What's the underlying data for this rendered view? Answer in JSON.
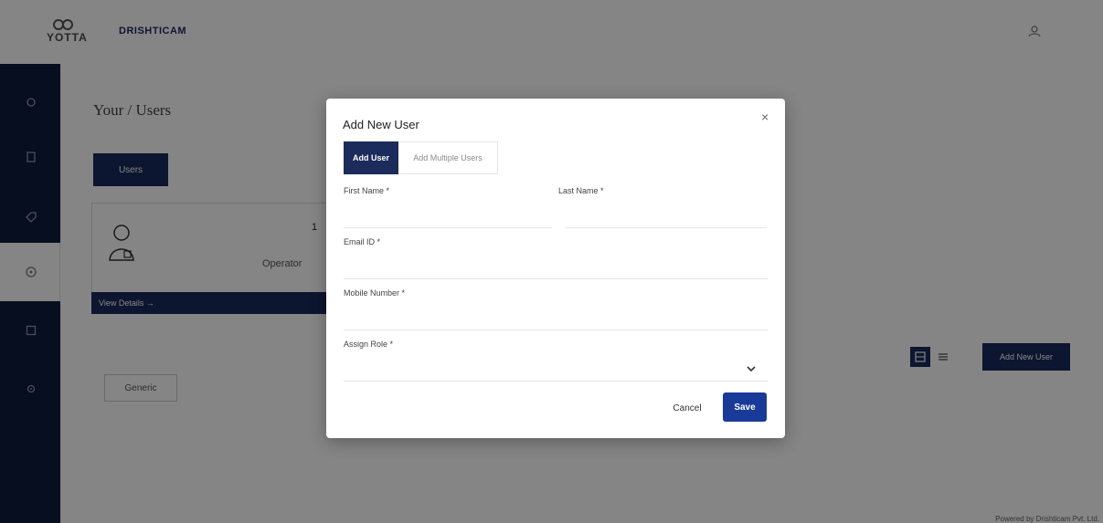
{
  "header": {
    "logo_text": "YOTTA",
    "brand": "DRISHTICAM",
    "profile_icon": "user-circle-icon"
  },
  "sidebar": {
    "items": [
      {
        "icon": "home-icon"
      },
      {
        "icon": "document-icon"
      },
      {
        "icon": "tag-icon"
      },
      {
        "icon": "users-icon",
        "active": true
      },
      {
        "icon": "square-icon"
      },
      {
        "icon": "settings-icon"
      }
    ]
  },
  "page": {
    "title": "Your / Users",
    "users_button": "Users",
    "card": {
      "number": "1",
      "role": "Operator",
      "footer": "View Details →"
    },
    "generic_button": "Generic",
    "add_new_user_button": "Add New User",
    "footer": "Powered by Drishticam Pvt. Ltd."
  },
  "modal": {
    "title": "Add New User",
    "close": "×",
    "tabs": [
      {
        "label": "Add User",
        "active": true
      },
      {
        "label": "Add Multiple Users",
        "active": false
      }
    ],
    "fields": {
      "first_name": {
        "label": "First Name *",
        "value": ""
      },
      "last_name": {
        "label": "Last Name *",
        "value": ""
      },
      "email": {
        "label": "Email ID *",
        "value": ""
      },
      "mobile": {
        "label": "Mobile Number *",
        "value": ""
      },
      "role": {
        "label": "Assign Role *",
        "value": ""
      }
    },
    "cancel_label": "Cancel",
    "save_label": "Save"
  },
  "colors": {
    "primary": "#1a2b5c",
    "save": "#1a3a9a",
    "overlay": "rgba(0,0,0,0.48)"
  }
}
